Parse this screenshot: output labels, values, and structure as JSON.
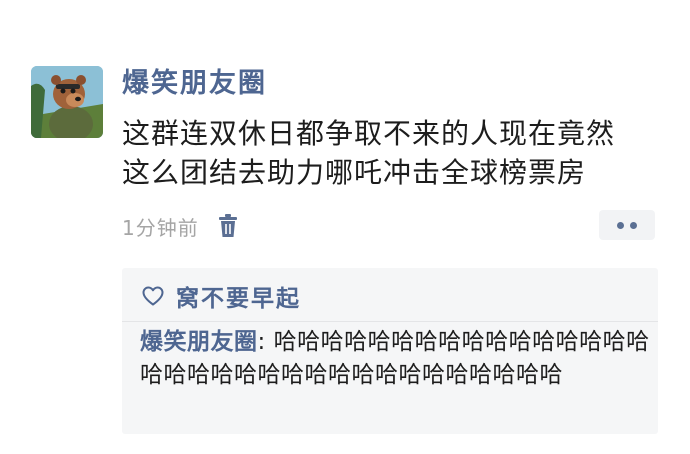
{
  "post": {
    "username": "爆笑朋友圈",
    "content_lines": [
      "这群连双休日都争取不来的人现在竟然",
      "这么团结去助力哪吒冲击全球榜票房"
    ],
    "timestamp": "1分钟前",
    "avatar_icon": "cartoon-bear-avatar",
    "delete_icon": "trash-icon",
    "more_icon": "more-dots-icon"
  },
  "likes": {
    "icon": "heart-icon",
    "names": "窝不要早起"
  },
  "comments": [
    {
      "author": "爆笑朋友圈",
      "separator": ": ",
      "text": "哈哈哈哈哈哈哈哈哈哈哈哈哈哈哈哈哈哈哈哈哈哈哈哈哈哈哈哈哈哈哈哈哈哈"
    }
  ],
  "colors": {
    "link": "#4e6691",
    "text": "#1d1d1d",
    "muted": "#a5a5a5",
    "panel": "#f5f6f7"
  }
}
